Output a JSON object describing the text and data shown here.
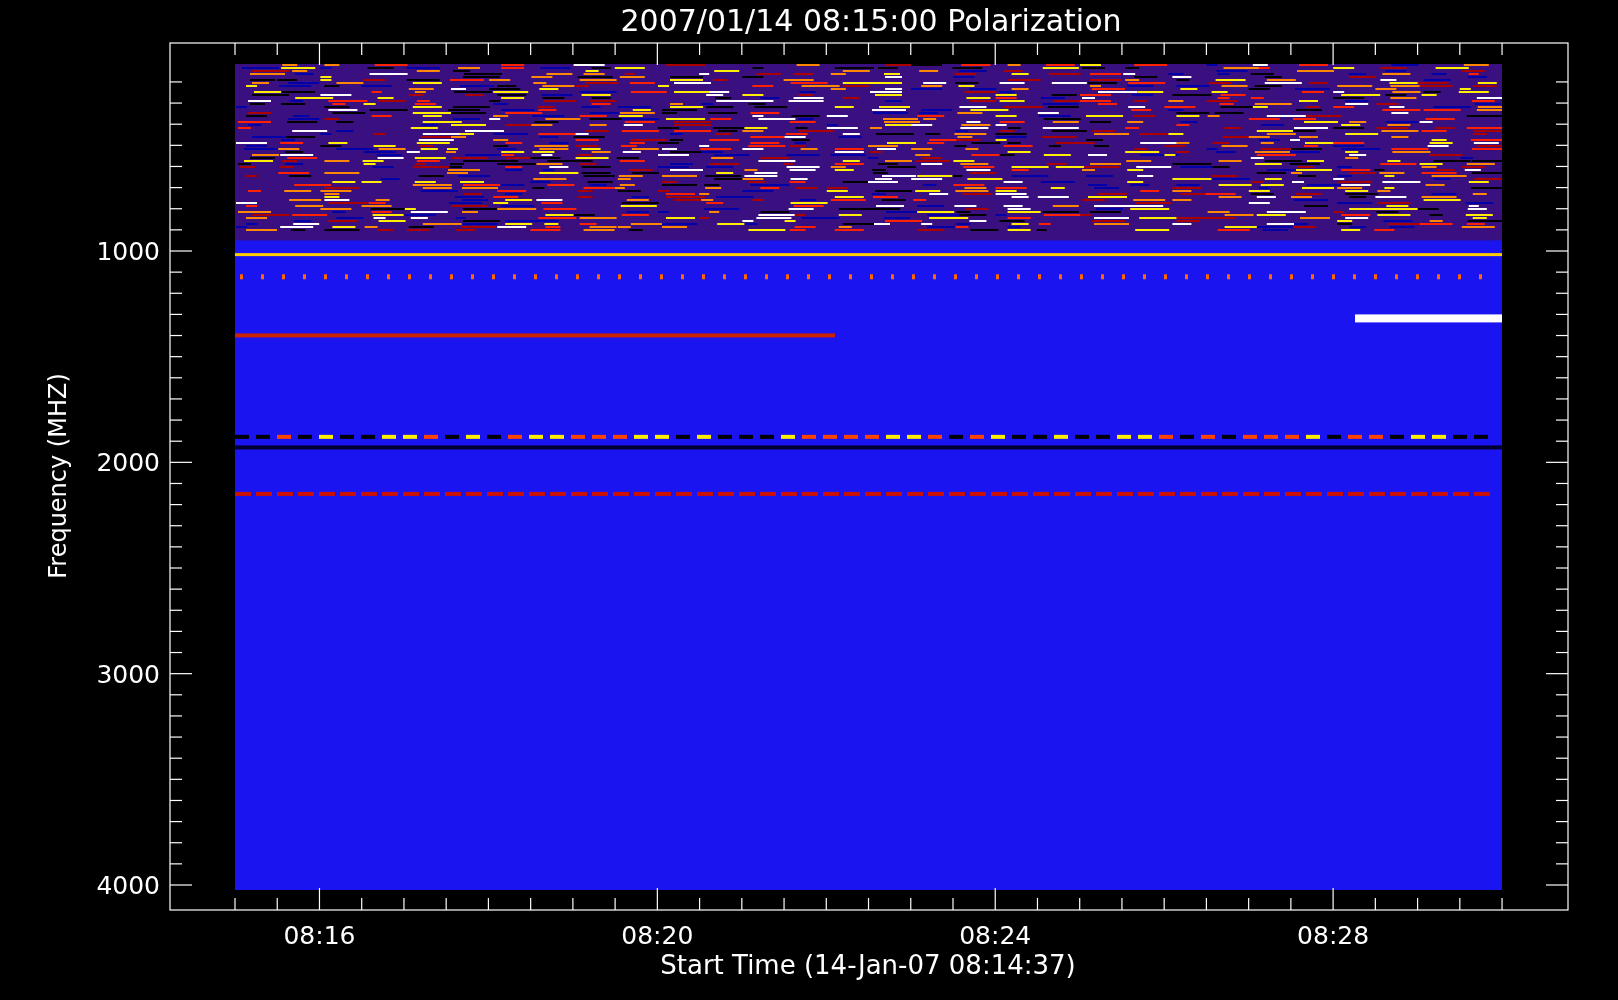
{
  "plot": {
    "title": "2007/01/14 08:15:00 Polarization",
    "ylabel": "Frequency (MHZ)",
    "xlabel": "Start Time (14-Jan-07 08:14:37)",
    "yticks": [
      "1000",
      "2000",
      "3000",
      "4000"
    ],
    "xticks": [
      "08:16",
      "08:20",
      "08:24",
      "08:28"
    ]
  }
}
